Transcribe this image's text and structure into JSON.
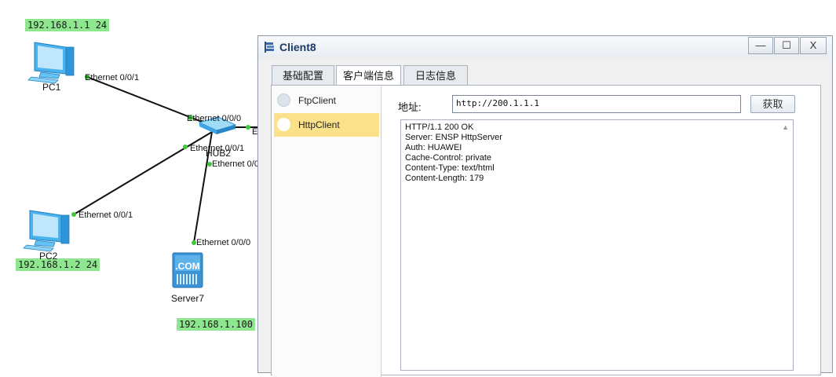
{
  "topology": {
    "ip_labels": [
      "192.168.1.1 24",
      "192.168.1.2 24",
      "192.168.1.100"
    ],
    "devices": {
      "pc1": "PC1",
      "pc2": "PC2",
      "hub": "HUB2",
      "server": "Server7",
      "server_badge": ".COM"
    },
    "ports": {
      "pc1_port": "Ethernet 0/0/1",
      "hub_port0": "Ethernet 0/0/0",
      "hub_port1": "Ethernet 0/0/1",
      "hub_port_partial": "Ethernet 0/0",
      "hub_right_stub": "E",
      "pc2_port": "Ethernet 0/0/1",
      "server_port": "Ethernet 0/0/0"
    },
    "colors": {
      "ip_label_bg": "#8ee68e",
      "link_dot": "#3cc93c"
    }
  },
  "window": {
    "title": "Client8",
    "controls": {
      "minimize": "—",
      "maximize": "☐",
      "close": "X"
    },
    "tabs": [
      {
        "label": "基础配置",
        "active": false
      },
      {
        "label": "客户端信息",
        "active": true
      },
      {
        "label": "日志信息",
        "active": false
      }
    ],
    "client_list": [
      {
        "label": "FtpClient",
        "selected": false
      },
      {
        "label": "HttpClient",
        "selected": true
      }
    ],
    "address_label": "地址:",
    "address_value": "http://200.1.1.1",
    "fetch_button": "获取",
    "response_lines": [
      "HTTP/1.1 200 OK",
      "Server: ENSP HttpServer",
      "Auth: HUAWEI",
      "Cache-Control: private",
      "Content-Type: text/html",
      "Content-Length: 179"
    ],
    "colors": {
      "selected_item": "#fbe18a",
      "title_text": "#1d3a66"
    }
  }
}
